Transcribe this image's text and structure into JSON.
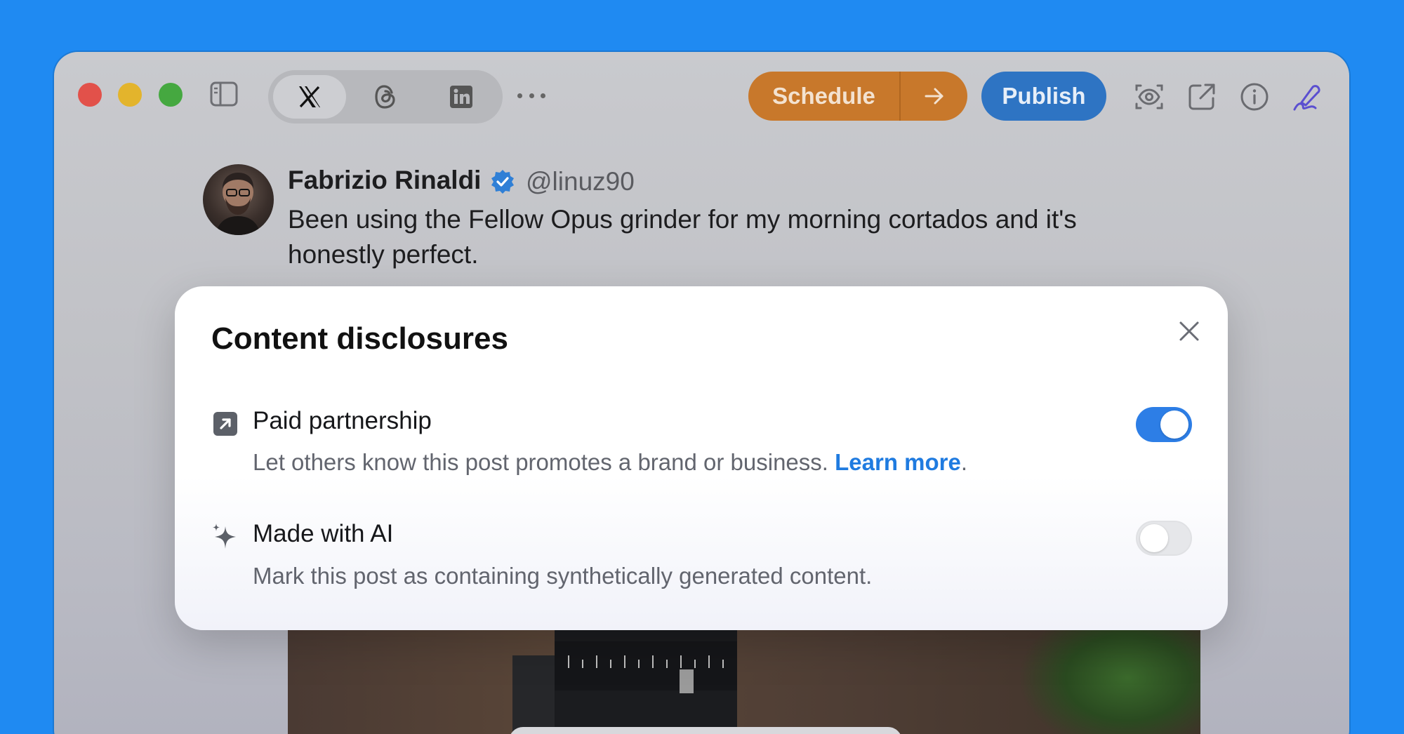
{
  "toolbar": {
    "platforms": [
      {
        "name": "X",
        "icon": "x-logo-icon",
        "active": true
      },
      {
        "name": "Threads",
        "icon": "threads-logo-icon",
        "active": false
      },
      {
        "name": "LinkedIn",
        "icon": "linkedin-logo-icon",
        "active": false
      }
    ],
    "schedule_label": "Schedule",
    "publish_label": "Publish",
    "colors": {
      "schedule": "#c8782b",
      "publish": "#2e74c3",
      "accent_purple": "#5b4fd0"
    }
  },
  "post": {
    "author_name": "Fabrizio Rinaldi",
    "handle": "@linuz90",
    "text": "Been using the Fellow Opus grinder for my morning cortados and it's honestly perfect."
  },
  "modal": {
    "title": "Content disclosures",
    "rows": [
      {
        "title": "Paid partnership",
        "description": "Let others know this post promotes a brand or business.",
        "link": "Learn more",
        "suffix": ".",
        "enabled": true
      },
      {
        "title": "Made with AI",
        "description": "Mark this post as containing synthetically generated content.",
        "enabled": false
      }
    ]
  }
}
